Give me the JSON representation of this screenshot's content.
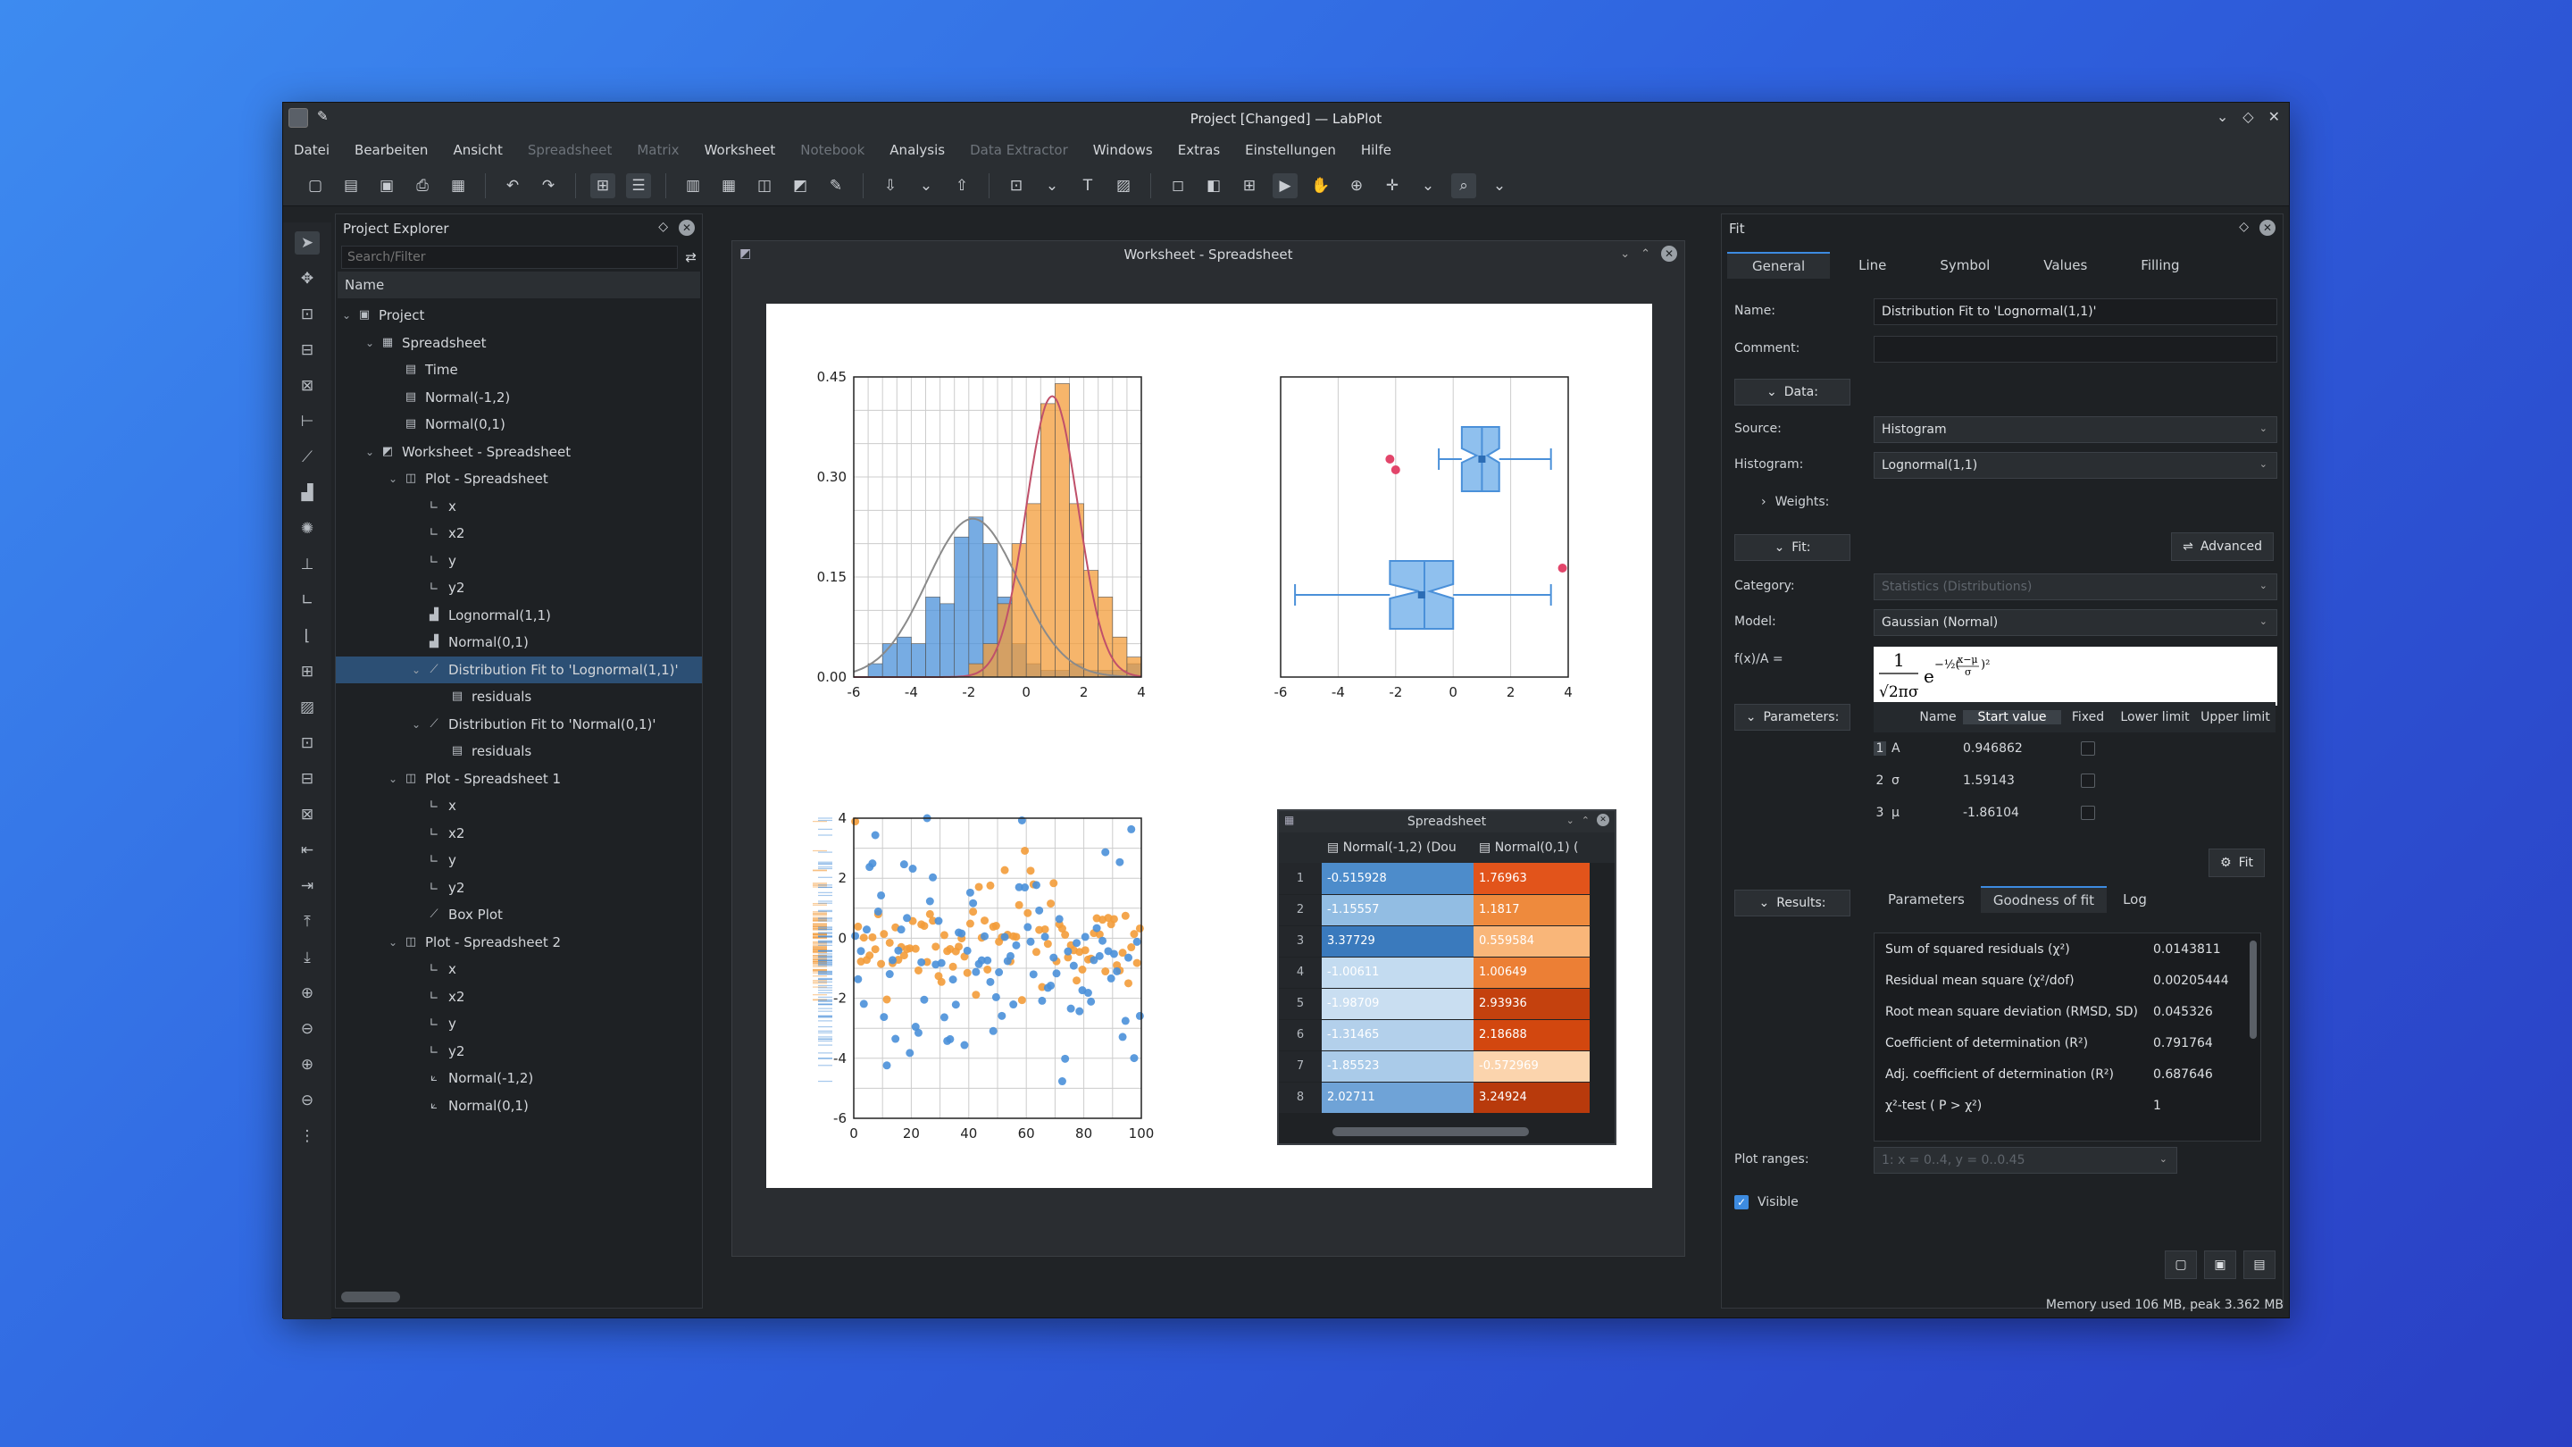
{
  "window": {
    "title": "Project [Changed] — LabPlot"
  },
  "menu": [
    "Datei",
    "Bearbeiten",
    "Ansicht",
    "Spreadsheet",
    "Matrix",
    "Worksheet",
    "Notebook",
    "Analysis",
    "Data Extractor",
    "Windows",
    "Extras",
    "Einstellungen",
    "Hilfe"
  ],
  "menu_disabled": [
    "Spreadsheet",
    "Matrix",
    "Notebook",
    "Data Extractor"
  ],
  "explorer": {
    "title": "Project Explorer",
    "search_placeholder": "Search/Filter",
    "column": "Name",
    "items": [
      {
        "label": "Project",
        "level": 0,
        "arrow": "v",
        "icon": "folder-icon"
      },
      {
        "label": "Spreadsheet",
        "level": 1,
        "arrow": "v",
        "icon": "spreadsheet-icon"
      },
      {
        "label": "Time",
        "level": 2,
        "arrow": "",
        "icon": "column-icon"
      },
      {
        "label": "Normal(-1,2)",
        "level": 2,
        "arrow": "",
        "icon": "column-icon"
      },
      {
        "label": "Normal(0,1)",
        "level": 2,
        "arrow": "",
        "icon": "column-icon"
      },
      {
        "label": "Worksheet - Spreadsheet",
        "level": 1,
        "arrow": "v",
        "icon": "worksheet-icon"
      },
      {
        "label": "Plot - Spreadsheet",
        "level": 2,
        "arrow": "v",
        "icon": "plot-icon"
      },
      {
        "label": "x",
        "level": 3,
        "arrow": "",
        "icon": "axis-icon"
      },
      {
        "label": "x2",
        "level": 3,
        "arrow": "",
        "icon": "axis-icon"
      },
      {
        "label": "y",
        "level": 3,
        "arrow": "",
        "icon": "axis-icon"
      },
      {
        "label": "y2",
        "level": 3,
        "arrow": "",
        "icon": "axis-icon"
      },
      {
        "label": "Lognormal(1,1)",
        "level": 3,
        "arrow": "",
        "icon": "histogram-icon"
      },
      {
        "label": "Normal(0,1)",
        "level": 3,
        "arrow": "",
        "icon": "histogram-icon"
      },
      {
        "label": "Distribution Fit to 'Lognormal(1,1)'",
        "level": 3,
        "arrow": "v",
        "icon": "fit-icon",
        "selected": true
      },
      {
        "label": "residuals",
        "level": 4,
        "arrow": "",
        "icon": "column-icon"
      },
      {
        "label": "Distribution Fit to 'Normal(0,1)'",
        "level": 3,
        "arrow": "v",
        "icon": "fit-icon"
      },
      {
        "label": "residuals",
        "level": 4,
        "arrow": "",
        "icon": "column-icon"
      },
      {
        "label": "Plot - Spreadsheet 1",
        "level": 2,
        "arrow": "v",
        "icon": "plot-icon"
      },
      {
        "label": "x",
        "level": 3,
        "arrow": "",
        "icon": "axis-icon"
      },
      {
        "label": "x2",
        "level": 3,
        "arrow": "",
        "icon": "axis-icon"
      },
      {
        "label": "y",
        "level": 3,
        "arrow": "",
        "icon": "axis-icon"
      },
      {
        "label": "y2",
        "level": 3,
        "arrow": "",
        "icon": "axis-icon"
      },
      {
        "label": "Box Plot",
        "level": 3,
        "arrow": "",
        "icon": "boxplot-icon"
      },
      {
        "label": "Plot - Spreadsheet 2",
        "level": 2,
        "arrow": "v",
        "icon": "plot-icon"
      },
      {
        "label": "x",
        "level": 3,
        "arrow": "",
        "icon": "axis-icon"
      },
      {
        "label": "x2",
        "level": 3,
        "arrow": "",
        "icon": "axis-icon"
      },
      {
        "label": "y",
        "level": 3,
        "arrow": "",
        "icon": "axis-icon"
      },
      {
        "label": "y2",
        "level": 3,
        "arrow": "",
        "icon": "axis-icon"
      },
      {
        "label": "Normal(-1,2)",
        "level": 3,
        "arrow": "",
        "icon": "curve-icon"
      },
      {
        "label": "Normal(0,1)",
        "level": 3,
        "arrow": "",
        "icon": "curve-icon"
      }
    ]
  },
  "worksheet": {
    "title": "Worksheet - Spreadsheet"
  },
  "colors": {
    "blue": "#4a90d9",
    "orange": "#f39c3a",
    "red_point": "#e2456a",
    "selection": "#2c4f74",
    "accent": "#3d8be0"
  },
  "chart_data": [
    {
      "type": "bar",
      "name": "histogram",
      "xticks": [
        "-6",
        "-4",
        "-2",
        "0",
        "2",
        "4"
      ],
      "yticks": [
        "0.00",
        "0.15",
        "0.30",
        "0.45"
      ],
      "xlim": [
        -6,
        4
      ],
      "ylim": [
        0,
        0.45
      ],
      "bin_width": 0.5,
      "series": [
        {
          "color": "#4a90d9",
          "bin_starts": [
            -5.5,
            -5,
            -4.5,
            -4,
            -3.5,
            -3,
            -2.5,
            -2,
            -1.5,
            -1,
            -0.5,
            0,
            0.5,
            1,
            1.5,
            2,
            2.5,
            3,
            3.5
          ],
          "values": [
            0.02,
            0.05,
            0.06,
            0.05,
            0.12,
            0.11,
            0.21,
            0.24,
            0.2,
            0.12,
            0.05,
            0.02,
            0.01,
            0.01,
            0.02,
            0.01,
            0.01,
            0.01,
            0.02
          ]
        },
        {
          "color": "#f39c3a",
          "bin_starts": [
            -2,
            -1.5,
            -1,
            -0.5,
            0,
            0.5,
            1,
            1.5,
            2,
            2.5,
            3,
            3.5
          ],
          "values": [
            0.02,
            0.05,
            0.11,
            0.2,
            0.26,
            0.41,
            0.44,
            0.26,
            0.16,
            0.12,
            0.06,
            0.03
          ]
        }
      ],
      "curves": [
        {
          "color": "#8a8a8a",
          "kind": "normal",
          "mu": -1.86104,
          "sigma": 1.59143,
          "A": 0.946862
        },
        {
          "color": "#c0506a",
          "kind": "normal",
          "mu": 0.9,
          "sigma": 0.9,
          "A": 0.95
        }
      ]
    },
    {
      "type": "boxplot",
      "xticks": [
        "-6",
        "-4",
        "-2",
        "0",
        "2",
        "4"
      ],
      "xlim": [
        -6,
        4
      ],
      "boxes": [
        {
          "color": "#4a90d9",
          "whisker_low": -0.5,
          "q1": 0.3,
          "median": 1.0,
          "q3": 1.6,
          "whisker_high": 3.4,
          "mean": 1.0,
          "outliers": [
            -2.2,
            -2.0
          ]
        },
        {
          "color": "#4a90d9",
          "whisker_low": -5.5,
          "q1": -2.2,
          "median": -1.0,
          "q3": 0.0,
          "whisker_high": 3.4,
          "mean": -1.1,
          "outliers": [
            3.8
          ]
        }
      ]
    },
    {
      "type": "scatter",
      "xticks": [
        "0",
        "20",
        "40",
        "60",
        "80",
        "100"
      ],
      "yticks": [
        "4",
        "2",
        "0",
        "-2",
        "-4",
        "-6"
      ],
      "xlim": [
        0,
        100
      ],
      "ylim": [
        -6,
        4
      ],
      "series": [
        {
          "color": "#f39c3a",
          "mean": 0,
          "sd": 1
        },
        {
          "color": "#4a90d9",
          "mean": -1,
          "sd": 2
        }
      ]
    }
  ],
  "sheet": {
    "title": "Spreadsheet",
    "columns": [
      "Normal(-1,2) (Dou",
      "Normal(0,1) ("
    ],
    "rows": [
      {
        "n": "1",
        "a": "-0.515928",
        "b": "1.76963"
      },
      {
        "n": "2",
        "a": "-1.15557",
        "b": "1.1817"
      },
      {
        "n": "3",
        "a": "3.37729",
        "b": "0.559584"
      },
      {
        "n": "4",
        "a": "-1.00611",
        "b": "1.00649"
      },
      {
        "n": "5",
        "a": "-1.98709",
        "b": "2.93936"
      },
      {
        "n": "6",
        "a": "-1.31465",
        "b": "2.18688"
      },
      {
        "n": "7",
        "a": "-1.85523",
        "b": "-0.572969"
      },
      {
        "n": "8",
        "a": "2.02711",
        "b": "3.24924"
      }
    ],
    "row_colors_a": [
      "#4d8ccb",
      "#92bde3",
      "#3a7abd",
      "#c3dbf0",
      "#c9def1",
      "#b3d0eb",
      "#aacbe9",
      "#6fa3d7"
    ],
    "row_colors_b": [
      "#e2541b",
      "#ee8a3d",
      "#f9b679",
      "#ec7f35",
      "#c4410e",
      "#d2470f",
      "#fbd4ad",
      "#b83a0c"
    ]
  },
  "fit": {
    "title": "Fit",
    "tabs": [
      "General",
      "Line",
      "Symbol",
      "Values",
      "Filling"
    ],
    "name_label": "Name:",
    "name_value": "Distribution Fit to 'Lognormal(1,1)'",
    "comment_label": "Comment:",
    "comment_value": "",
    "data_btn": "Data:",
    "source_label": "Source:",
    "source_value": "Histogram",
    "histogram_label": "Histogram:",
    "histogram_value": "Lognormal(1,1)",
    "weights": "Weights:",
    "fit_btn": "Fit:",
    "advanced_btn": "Advanced",
    "category_label": "Category:",
    "category_value": "Statistics (Distributions)",
    "model_label": "Model:",
    "model_value": "Gaussian (Normal)",
    "formula_label": "f(x)/A =",
    "parameters_btn": "Parameters:",
    "param_headers": [
      "Name",
      "Start value",
      "Fixed",
      "Lower limit",
      "Upper limit"
    ],
    "params": [
      {
        "n": "1",
        "name": "A",
        "value": "0.946862"
      },
      {
        "n": "2",
        "name": "σ",
        "value": "1.59143"
      },
      {
        "n": "3",
        "name": "μ",
        "value": "-1.86104"
      }
    ],
    "fit_button": "Fit",
    "results_btn": "Results:",
    "result_tabs": [
      "Parameters",
      "Goodness of fit",
      "Log"
    ],
    "results": [
      {
        "label": "Sum of squared residuals (χ²)",
        "value": "0.0143811"
      },
      {
        "label": "Residual mean square (χ²/dof)",
        "value": "0.00205444"
      },
      {
        "label": "Root mean square deviation (RMSD, SD)",
        "value": "0.045326"
      },
      {
        "label": "Coefficient of determination (R²)",
        "value": "0.791764"
      },
      {
        "label": "Adj. coefficient of determination (R̄²)",
        "value": "0.687646"
      },
      {
        "label": "χ²-test ( P > χ²)",
        "value": "1"
      }
    ],
    "plot_ranges_label": "Plot ranges:",
    "plot_ranges_value": "1: x = 0..4, y = 0..0.45",
    "visible_label": "Visible"
  },
  "status": {
    "memory": "Memory used 106 MB, peak 3.362 MB"
  }
}
